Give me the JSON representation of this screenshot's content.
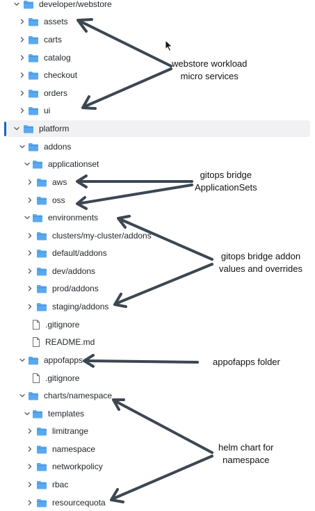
{
  "tree": {
    "rows": [
      {
        "label": "developer/webstore",
        "type": "folder",
        "depth": 0,
        "expanded": true
      },
      {
        "label": "assets",
        "type": "folder",
        "depth": 1,
        "expanded": false
      },
      {
        "label": "carts",
        "type": "folder",
        "depth": 1,
        "expanded": false
      },
      {
        "label": "catalog",
        "type": "folder",
        "depth": 1,
        "expanded": false
      },
      {
        "label": "checkout",
        "type": "folder",
        "depth": 1,
        "expanded": false
      },
      {
        "label": "orders",
        "type": "folder",
        "depth": 1,
        "expanded": false
      },
      {
        "label": "ui",
        "type": "folder",
        "depth": 1,
        "expanded": false
      },
      {
        "label": "platform",
        "type": "folder",
        "depth": 0,
        "expanded": true,
        "selected": true
      },
      {
        "label": "addons",
        "type": "folder",
        "depth": 1,
        "expanded": true
      },
      {
        "label": "applicationset",
        "type": "folder",
        "depth": 2,
        "expanded": true
      },
      {
        "label": "aws",
        "type": "folder",
        "depth": 3,
        "expanded": false
      },
      {
        "label": "oss",
        "type": "folder",
        "depth": 3,
        "expanded": false
      },
      {
        "label": "environments",
        "type": "folder",
        "depth": 2,
        "expanded": true
      },
      {
        "label": "clusters/my-cluster/addons",
        "type": "folder",
        "depth": 3,
        "expanded": false
      },
      {
        "label": "default/addons",
        "type": "folder",
        "depth": 3,
        "expanded": false
      },
      {
        "label": "dev/addons",
        "type": "folder",
        "depth": 3,
        "expanded": false
      },
      {
        "label": "prod/addons",
        "type": "folder",
        "depth": 3,
        "expanded": false
      },
      {
        "label": "staging/addons",
        "type": "folder",
        "depth": 3,
        "expanded": false
      },
      {
        "label": ".gitignore",
        "type": "file",
        "depth": 2
      },
      {
        "label": "README.md",
        "type": "file",
        "depth": 2
      },
      {
        "label": "appofapps",
        "type": "folder",
        "depth": 1,
        "expanded": true
      },
      {
        "label": ".gitignore",
        "type": "file",
        "depth": 2
      },
      {
        "label": "charts/namespace",
        "type": "folder",
        "depth": 1,
        "expanded": true
      },
      {
        "label": "templates",
        "type": "folder",
        "depth": 2,
        "expanded": true
      },
      {
        "label": "limitrange",
        "type": "folder",
        "depth": 3,
        "expanded": false
      },
      {
        "label": "namespace",
        "type": "folder",
        "depth": 3,
        "expanded": false
      },
      {
        "label": "networkpolicy",
        "type": "folder",
        "depth": 3,
        "expanded": false
      },
      {
        "label": "rbac",
        "type": "folder",
        "depth": 3,
        "expanded": false
      },
      {
        "label": "resourcequota",
        "type": "folder",
        "depth": 3,
        "expanded": false
      }
    ]
  },
  "annotations": {
    "webstore": {
      "line1": "webstore workload",
      "line2": "micro services"
    },
    "appsets": {
      "line1": "gitops bridge",
      "line2": "ApplicationSets"
    },
    "addon_values": {
      "line1": "gitops bridge addon",
      "line2": "values and overrides"
    },
    "appofapps": {
      "line1": "appofapps folder"
    },
    "helm": {
      "line1": "helm chart for",
      "line2": "namespace"
    }
  },
  "colors": {
    "folder": "#5aa9f0",
    "folder_tab": "#3d8fe0",
    "arrow": "#3c4752",
    "selection_bg": "#f1f1f3",
    "selection_indicator": "#1664c8",
    "chevron": "#5b6066"
  },
  "icons": {
    "folder": "folder-icon",
    "file": "file-icon",
    "expanded": "chevron-down-icon",
    "collapsed": "chevron-right-icon"
  }
}
